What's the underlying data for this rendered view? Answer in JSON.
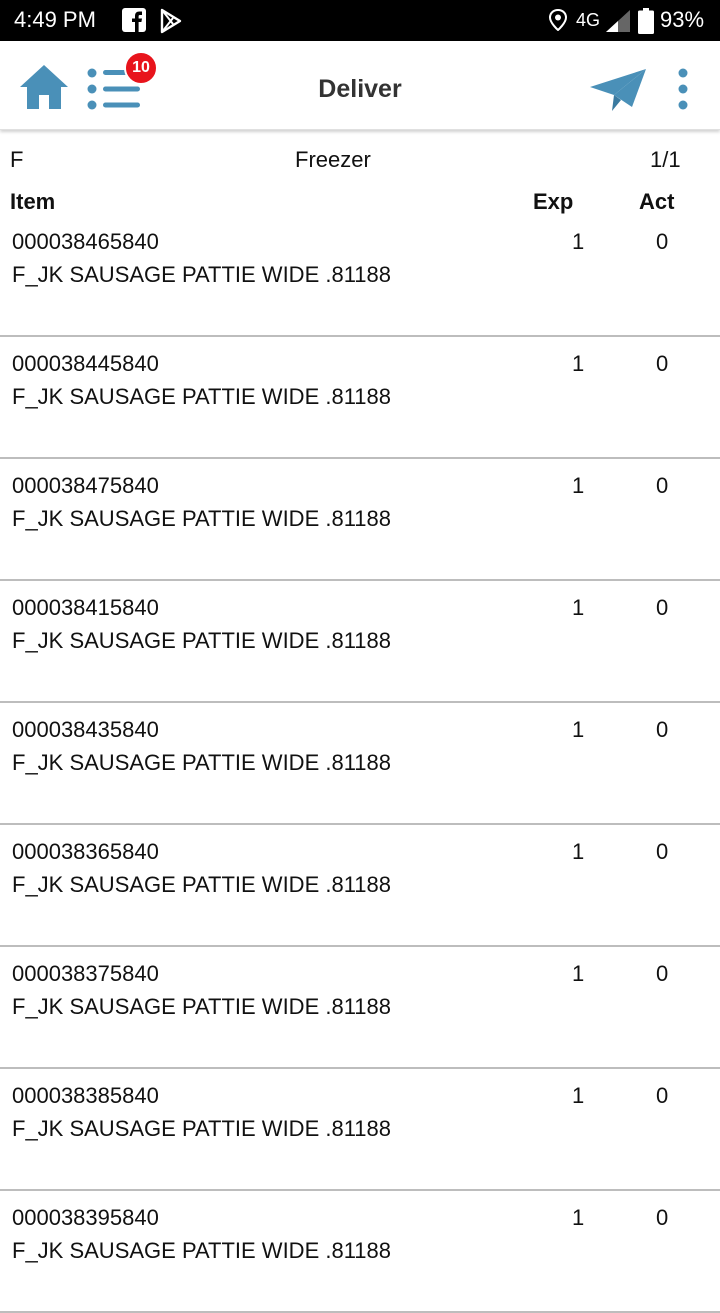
{
  "status_bar": {
    "time": "4:49 PM",
    "network": "4G",
    "battery": "93%"
  },
  "app_bar": {
    "title": "Deliver",
    "badge_count": "10",
    "accent_color": "#4a90b8"
  },
  "section": {
    "zone_code": "F",
    "zone_name": "Freezer",
    "page": "1/1"
  },
  "columns": {
    "item": "Item",
    "exp": "Exp",
    "act": "Act"
  },
  "items": [
    {
      "code": "000038465840",
      "description": "F_JK SAUSAGE PATTIE WIDE .81188",
      "exp": "1",
      "act": "0"
    },
    {
      "code": "000038445840",
      "description": "F_JK SAUSAGE PATTIE WIDE .81188",
      "exp": "1",
      "act": "0"
    },
    {
      "code": "000038475840",
      "description": "F_JK SAUSAGE PATTIE WIDE .81188",
      "exp": "1",
      "act": "0"
    },
    {
      "code": "000038415840",
      "description": "F_JK SAUSAGE PATTIE WIDE .81188",
      "exp": "1",
      "act": "0"
    },
    {
      "code": "000038435840",
      "description": "F_JK SAUSAGE PATTIE WIDE .81188",
      "exp": "1",
      "act": "0"
    },
    {
      "code": "000038365840",
      "description": "F_JK SAUSAGE PATTIE WIDE .81188",
      "exp": "1",
      "act": "0"
    },
    {
      "code": "000038375840",
      "description": "F_JK SAUSAGE PATTIE WIDE .81188",
      "exp": "1",
      "act": "0"
    },
    {
      "code": "000038385840",
      "description": "F_JK SAUSAGE PATTIE WIDE .81188",
      "exp": "1",
      "act": "0"
    },
    {
      "code": "000038395840",
      "description": "F_JK SAUSAGE PATTIE WIDE .81188",
      "exp": "1",
      "act": "0"
    }
  ]
}
